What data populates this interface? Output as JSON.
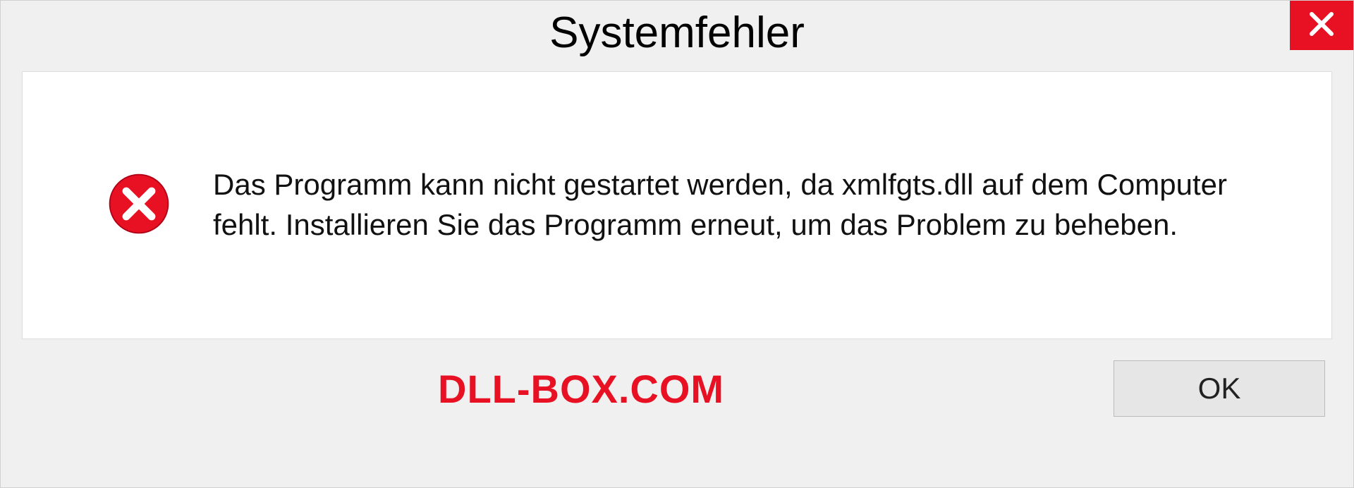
{
  "dialog": {
    "title": "Systemfehler",
    "message": "Das Programm kann nicht gestartet werden, da xmlfgts.dll auf dem Computer fehlt. Installieren Sie das Programm erneut, um das Problem zu beheben.",
    "ok_label": "OK"
  },
  "watermark": "DLL-BOX.COM"
}
